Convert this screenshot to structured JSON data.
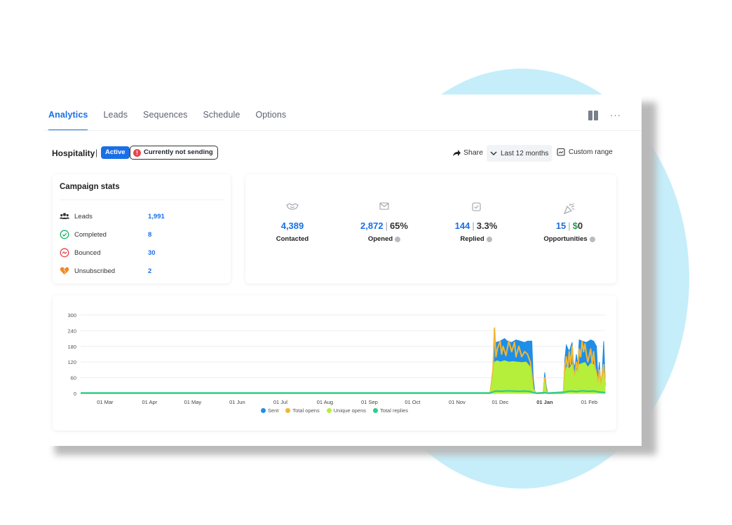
{
  "tabs": [
    {
      "label": "Analytics",
      "active": true
    },
    {
      "label": "Leads",
      "active": false
    },
    {
      "label": "Sequences",
      "active": false
    },
    {
      "label": "Schedule",
      "active": false
    },
    {
      "label": "Options",
      "active": false
    }
  ],
  "header": {
    "campaign_name": "Hospitality",
    "separator": "|",
    "status_badge": "Active",
    "warning_badge": "Currently not sending",
    "share_label": "Share",
    "range_label": "Last 12 months",
    "custom_range_label": "Custom range"
  },
  "campaign_stats": {
    "title": "Campaign stats",
    "rows": [
      {
        "label": "Leads",
        "value": "1,991",
        "icon": "users-icon"
      },
      {
        "label": "Completed",
        "value": "8",
        "icon": "check-circle-icon"
      },
      {
        "label": "Bounced",
        "value": "30",
        "icon": "bounce-icon"
      },
      {
        "label": "Unsubscribed",
        "value": "2",
        "icon": "broken-heart-icon"
      }
    ]
  },
  "kpis": {
    "contacted": {
      "value": "4,389",
      "label": "Contacted",
      "icon": "handshake-icon"
    },
    "opened": {
      "value": "2,872",
      "sep": "|",
      "rate": "65%",
      "label": "Opened",
      "icon": "envelope-icon"
    },
    "replied": {
      "value": "144",
      "sep": "|",
      "rate": "3.3%",
      "label": "Replied",
      "icon": "check-square-icon"
    },
    "opportunities": {
      "value": "15",
      "sep": "|",
      "amount_symbol": "$",
      "amount": "0",
      "label": "Opportunities",
      "icon": "party-popper-icon"
    }
  },
  "colors": {
    "accent": "#1a6fe6",
    "sent": "#1f8ee8",
    "total_opens": "#f2b632",
    "unique_opens": "#b5ee3b",
    "total_replies": "#2ecc8e"
  },
  "chart_data": {
    "type": "area",
    "y_ticks": [
      0,
      60,
      120,
      180,
      240,
      300
    ],
    "ylim": [
      0,
      300
    ],
    "x_ticks": [
      "01 Mar",
      "01 Apr",
      "01 May",
      "01 Jun",
      "01 Jul",
      "01 Aug",
      "01 Sep",
      "01 Oct",
      "01 Nov",
      "01 Dec",
      "01 Jan",
      "01 Feb"
    ],
    "x_tick_index": [
      0,
      31,
      61,
      92,
      122,
      153,
      184,
      214,
      245,
      275,
      306,
      337
    ],
    "x_domain": [
      -17,
      348
    ],
    "legend_position": "bottom",
    "series": [
      {
        "name": "Sent",
        "points": [
          [
            -17,
            0
          ],
          [
            268,
            0
          ],
          [
            270,
            40
          ],
          [
            271,
            200
          ],
          [
            272,
            195
          ],
          [
            275,
            200
          ],
          [
            278,
            210
          ],
          [
            280,
            200
          ],
          [
            283,
            195
          ],
          [
            286,
            205
          ],
          [
            289,
            200
          ],
          [
            292,
            195
          ],
          [
            294,
            200
          ],
          [
            297,
            200
          ],
          [
            298,
            60
          ],
          [
            299,
            10
          ],
          [
            300,
            0
          ],
          [
            305,
            0
          ],
          [
            306,
            80
          ],
          [
            307,
            30
          ],
          [
            308,
            0
          ],
          [
            319,
            0
          ],
          [
            320,
            130
          ],
          [
            321,
            185
          ],
          [
            323,
            160
          ],
          [
            325,
            195
          ],
          [
            326,
            120
          ],
          [
            327,
            100
          ],
          [
            328,
            150
          ],
          [
            329,
            110
          ],
          [
            330,
            205
          ],
          [
            332,
            200
          ],
          [
            335,
            195
          ],
          [
            338,
            205
          ],
          [
            340,
            200
          ],
          [
            342,
            180
          ],
          [
            343,
            60
          ],
          [
            344,
            120
          ],
          [
            345,
            40
          ],
          [
            346,
            80
          ],
          [
            347,
            200
          ],
          [
            348,
            60
          ]
        ]
      },
      {
        "name": "Total opens",
        "points": [
          [
            -17,
            0
          ],
          [
            268,
            0
          ],
          [
            270,
            90
          ],
          [
            271,
            250
          ],
          [
            272,
            140
          ],
          [
            273,
            170
          ],
          [
            275,
            200
          ],
          [
            276,
            150
          ],
          [
            277,
            180
          ],
          [
            279,
            145
          ],
          [
            281,
            200
          ],
          [
            283,
            160
          ],
          [
            285,
            195
          ],
          [
            286,
            140
          ],
          [
            288,
            180
          ],
          [
            290,
            140
          ],
          [
            292,
            160
          ],
          [
            294,
            150
          ],
          [
            296,
            120
          ],
          [
            297,
            70
          ],
          [
            298,
            20
          ],
          [
            299,
            5
          ],
          [
            300,
            0
          ],
          [
            305,
            0
          ],
          [
            306,
            60
          ],
          [
            307,
            10
          ],
          [
            308,
            0
          ],
          [
            319,
            0
          ],
          [
            320,
            100
          ],
          [
            321,
            140
          ],
          [
            322,
            90
          ],
          [
            323,
            160
          ],
          [
            324,
            110
          ],
          [
            325,
            180
          ],
          [
            326,
            90
          ],
          [
            327,
            70
          ],
          [
            328,
            120
          ],
          [
            329,
            80
          ],
          [
            330,
            170
          ],
          [
            331,
            140
          ],
          [
            332,
            200
          ],
          [
            333,
            160
          ],
          [
            334,
            190
          ],
          [
            335,
            150
          ],
          [
            336,
            120
          ],
          [
            338,
            170
          ],
          [
            339,
            110
          ],
          [
            340,
            160
          ],
          [
            341,
            100
          ],
          [
            342,
            80
          ],
          [
            343,
            40
          ],
          [
            344,
            90
          ],
          [
            345,
            30
          ],
          [
            346,
            70
          ],
          [
            347,
            110
          ],
          [
            348,
            30
          ]
        ]
      },
      {
        "name": "Unique opens",
        "points": [
          [
            -17,
            0
          ],
          [
            268,
            0
          ],
          [
            270,
            70
          ],
          [
            271,
            120
          ],
          [
            273,
            125
          ],
          [
            275,
            120
          ],
          [
            278,
            125
          ],
          [
            281,
            120
          ],
          [
            284,
            122
          ],
          [
            287,
            120
          ],
          [
            290,
            118
          ],
          [
            293,
            120
          ],
          [
            296,
            100
          ],
          [
            297,
            55
          ],
          [
            298,
            15
          ],
          [
            299,
            3
          ],
          [
            300,
            0
          ],
          [
            305,
            0
          ],
          [
            306,
            45
          ],
          [
            307,
            8
          ],
          [
            308,
            0
          ],
          [
            319,
            0
          ],
          [
            320,
            70
          ],
          [
            321,
            100
          ],
          [
            323,
            95
          ],
          [
            325,
            110
          ],
          [
            326,
            80
          ],
          [
            327,
            60
          ],
          [
            328,
            90
          ],
          [
            329,
            70
          ],
          [
            330,
            110
          ],
          [
            332,
            115
          ],
          [
            334,
            118
          ],
          [
            336,
            100
          ],
          [
            338,
            115
          ],
          [
            340,
            110
          ],
          [
            342,
            70
          ],
          [
            343,
            30
          ],
          [
            344,
            60
          ],
          [
            345,
            25
          ],
          [
            346,
            50
          ],
          [
            347,
            80
          ],
          [
            348,
            25
          ]
        ]
      },
      {
        "name": "Total replies",
        "points": [
          [
            -17,
            2
          ],
          [
            268,
            2
          ],
          [
            270,
            6
          ],
          [
            272,
            9
          ],
          [
            276,
            8
          ],
          [
            280,
            10
          ],
          [
            284,
            9
          ],
          [
            288,
            8
          ],
          [
            292,
            9
          ],
          [
            296,
            7
          ],
          [
            298,
            3
          ],
          [
            300,
            1
          ],
          [
            306,
            3
          ],
          [
            308,
            1
          ],
          [
            320,
            5
          ],
          [
            324,
            9
          ],
          [
            328,
            7
          ],
          [
            332,
            10
          ],
          [
            336,
            8
          ],
          [
            340,
            9
          ],
          [
            344,
            5
          ],
          [
            348,
            3
          ]
        ]
      }
    ]
  }
}
